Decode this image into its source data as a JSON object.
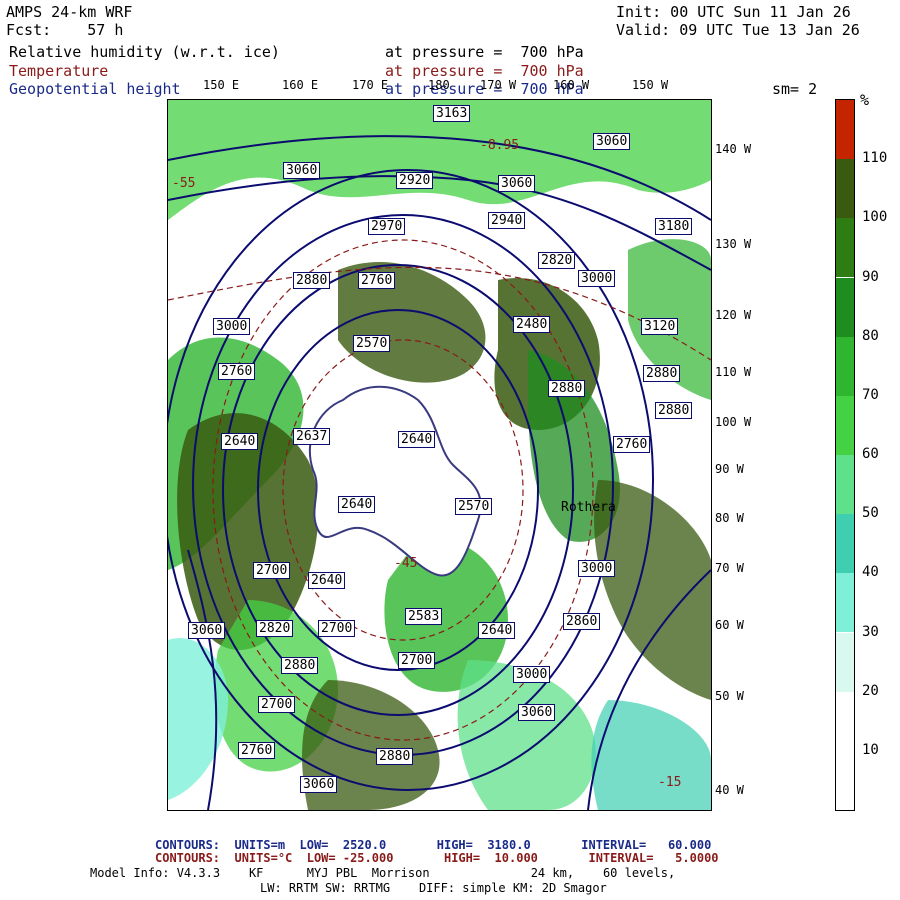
{
  "header": {
    "model": "AMPS 24-km WRF",
    "fcst": "Fcst:    57 h",
    "init": "Init: 00 UTC Sun 11 Jan 26",
    "valid": "Valid: 09 UTC Tue 13 Jan 26"
  },
  "fields": [
    {
      "name": "Relative humidity (w.r.t. ice)",
      "level": "at pressure =  700 hPa",
      "color": "#000000"
    },
    {
      "name": "Temperature",
      "level": "at pressure =  700 hPa",
      "color": "#8a1a1a"
    },
    {
      "name": "Geopotential height",
      "level": "at pressure =  700 hPa",
      "color": "#1a2a8a"
    }
  ],
  "smoothing": "sm= 2",
  "longitude_labels": [
    "150 E",
    "160 E",
    "170 E",
    "180",
    "170 W",
    "160 W",
    "150 W"
  ],
  "latitude_labels": [
    "140 W",
    "130 W",
    "120 W",
    "110 W",
    "100 W",
    "90 W",
    "80 W",
    "70 W",
    "60 W",
    "50 W",
    "40 W"
  ],
  "colorbar": {
    "unit": "%",
    "ticks": [
      "110",
      "100",
      "90",
      "80",
      "70",
      "60",
      "50",
      "40",
      "30",
      "20",
      "10"
    ],
    "colors": [
      "#c42400",
      "#3a5a10",
      "#2e7d12",
      "#1e8c1e",
      "#2fb52f",
      "#44d244",
      "#5fe08a",
      "#3fcfb0",
      "#7ef0d8",
      "#d8f8f0",
      "#ffffff",
      "#ffffff"
    ]
  },
  "map_labels": {
    "height_boxes": [
      "3163",
      "3060",
      "2920",
      "3060",
      "3000",
      "2940",
      "2970",
      "2820",
      "2880",
      "2760",
      "3180",
      "3000",
      "2760",
      "2480",
      "3120",
      "2880",
      "2570",
      "2880",
      "2640",
      "2637",
      "2640",
      "2700",
      "2640",
      "2570",
      "2640",
      "2700",
      "3060",
      "2820",
      "2700",
      "2880",
      "2583",
      "2700",
      "3000",
      "2860",
      "3060",
      "2640",
      "3000",
      "3060",
      "2880",
      "2760",
      "3060",
      "2880",
      "2760"
    ],
    "temperature_labels": [
      "-8.95",
      "-15",
      "-45",
      "-55"
    ],
    "place_labels": [
      "Rothera"
    ]
  },
  "footer": {
    "contours_height": "CONTOURS:  UNITS=m  LOW=  2520.0       HIGH=  3180.0       INTERVAL=   60.000",
    "contours_temp": "CONTOURS:  UNITS=°C  LOW= -25.000       HIGH=  10.000       INTERVAL=   5.0000",
    "model_info": "Model Info: V4.3.3    KF      MYJ PBL  Morrison              24 km,    60 levels,",
    "physics": "LW: RRTM SW: RRTMG    DIFF: simple KM: 2D Smagor"
  }
}
